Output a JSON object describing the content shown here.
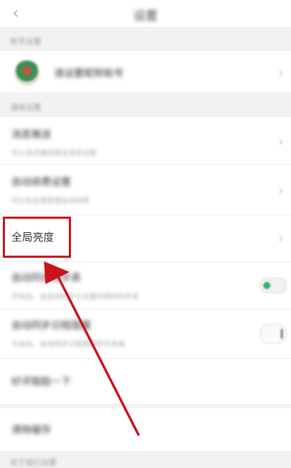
{
  "header": {
    "back_icon": "chevron-left-icon",
    "title": "设置"
  },
  "sections": {
    "account_label": "帐号设置",
    "general_label": "通用设置",
    "bottom_label": "关于我们设置"
  },
  "account": {
    "name": "请设置昵称账号"
  },
  "settings": [
    {
      "title": "消息推送",
      "subtitle": "可以关闭通知推送消息设置"
    },
    {
      "title": "自动续费设置",
      "subtitle": "可以在这里管理自动续费"
    },
    {
      "title": "全局亮度"
    },
    {
      "title": "自动同步到手表",
      "subtitle": "开启后，会自动同步已设置的闹钟到手表",
      "toggle": "on"
    },
    {
      "title": "自动同步日程提醒",
      "subtitle": "开启后，自动同步日程提醒到手表端",
      "toggle": "off"
    },
    {
      "title": "好评鼓励一下"
    },
    {
      "title": "清除缓存"
    }
  ],
  "colors": {
    "highlight": "#c8151b",
    "toggle_on": "#2fb36b"
  }
}
